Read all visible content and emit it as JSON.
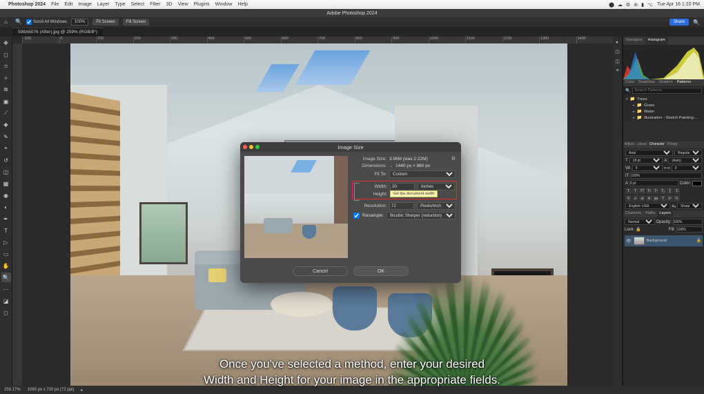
{
  "mac_menu": {
    "app": "Photoshop 2024",
    "items": [
      "File",
      "Edit",
      "Image",
      "Layer",
      "Type",
      "Select",
      "Filter",
      "3D",
      "View",
      "Plugins",
      "Window",
      "Help"
    ],
    "datetime": "Tue Apr 16  1:10 PM"
  },
  "app_title": "Adobe Photoshop 2024",
  "toolbar": {
    "scroll_all": "Scroll All Windows",
    "zoom": "100%",
    "fit_screen": "Fit Screen",
    "fill_screen": "Fill Screen",
    "share": "Share"
  },
  "document": {
    "tab": "598A6076 (After).jpg @ 259% (RGB/8*)"
  },
  "ruler_ticks": [
    "-100",
    "0",
    "100",
    "200",
    "300",
    "400",
    "500",
    "600",
    "700",
    "800",
    "900",
    "1000",
    "1100",
    "1200",
    "1300",
    "1400"
  ],
  "dialog": {
    "title": "Image Size",
    "image_size_label": "Image Size:",
    "image_size_value": "3.96M (was 2.22M)",
    "dimensions_label": "Dimensions:",
    "dimensions_value": "1440 px × 960 px",
    "fit_to_label": "Fit To:",
    "fit_to_value": "Custom",
    "width_label": "Width:",
    "width_value": "20",
    "width_unit": "Inches",
    "height_label": "Height:",
    "height_tooltip": "Set the document width",
    "resolution_label": "Resolution:",
    "resolution_value": "72",
    "resolution_unit": "Pixels/Inch",
    "resample_label": "Resample:",
    "resample_value": "Bicubic Sharper (reduction)",
    "cancel": "Cancel",
    "ok": "OK"
  },
  "right": {
    "nav_tabs": [
      "Navigator",
      "Histogram"
    ],
    "color_tabs": [
      "Color",
      "Swatches",
      "Gradien",
      "Patterns"
    ],
    "search_placeholder": "Search Patterns",
    "tree": [
      {
        "label": "Trees",
        "expanded": true
      },
      {
        "label": "Grass",
        "expanded": false
      },
      {
        "label": "Water",
        "expanded": false
      },
      {
        "label": "Illustration - Sketch Painting ...",
        "expanded": false
      }
    ],
    "adjust_tabs": [
      "Adjust",
      "Librari",
      "Character",
      "Paragr"
    ],
    "font_family": "Arial",
    "font_style": "Regular",
    "font_size": "18 pt",
    "leading": "(Auto)",
    "tracking_va": "0",
    "tracking": "0",
    "baseline": "100%",
    "other": "0 pt",
    "color_label": "Color:",
    "lang": "English: USA",
    "aa": "Sharp",
    "layers_tabs": [
      "Channels",
      "Paths",
      "Layers"
    ],
    "blend_mode": "Normal",
    "opacity_label": "Opacity:",
    "opacity": "100%",
    "lock_label": "Lock:",
    "fill_label": "Fill:",
    "fill": "100%",
    "layer_name": "Background"
  },
  "status": {
    "zoom": "259.17%",
    "info": "1080 px x 720 px (72 ppi)"
  },
  "caption": {
    "line1": "Once you've selected a method, enter your desired",
    "line2": "Width and Height for your image in the appropriate fields."
  }
}
